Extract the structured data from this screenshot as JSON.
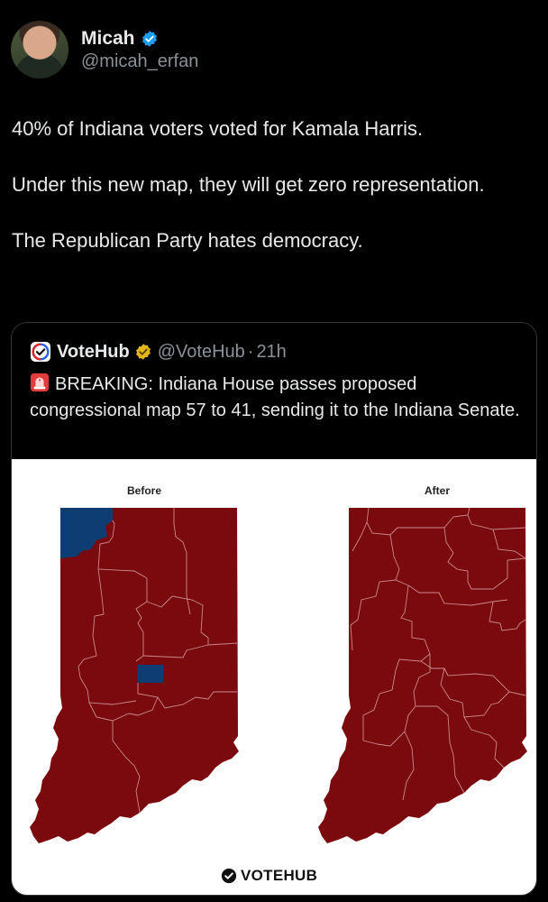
{
  "author": {
    "name": "Micah",
    "handle": "@micah_erfan"
  },
  "tweet": {
    "paragraphs": [
      "40% of Indiana voters voted for Kamala Harris.",
      "Under this new map, they will get zero representation.",
      "The Republican Party hates democracy."
    ]
  },
  "quoted": {
    "name": "VoteHub",
    "handle": "@VoteHub",
    "separator": "·",
    "time": "21h",
    "text": "BREAKING: Indiana House passes proposed congressional map 57 to 41, sending it to the Indiana Senate.",
    "image": {
      "before_label": "Before",
      "after_label": "After",
      "brand": "VOTEHUB",
      "colors": {
        "republican": "#7b0a0e",
        "democrat": "#0d3d73",
        "border": "#c98a8c"
      }
    }
  },
  "icons": {
    "verified": "verified-badge-icon",
    "gold_badge": "gold-verified-icon",
    "siren": "siren-emoji-icon",
    "votehub_logo": "votehub-logo-icon"
  }
}
